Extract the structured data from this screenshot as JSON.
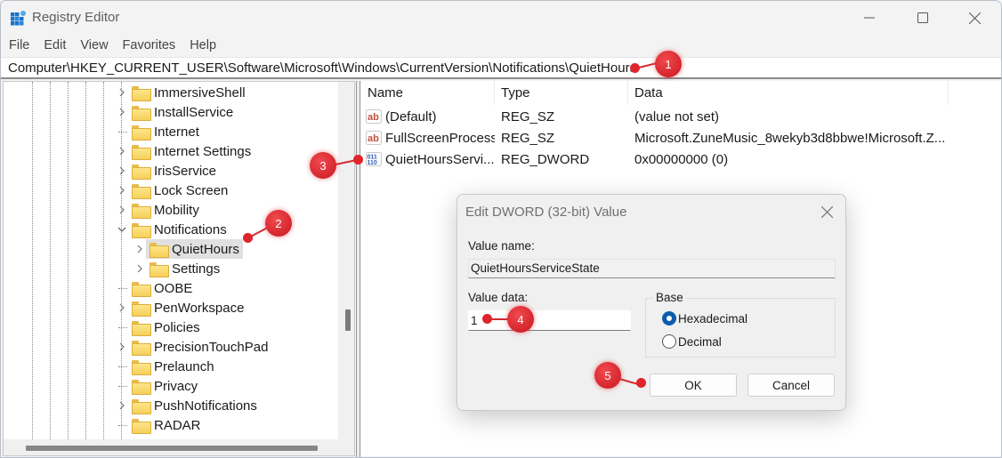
{
  "window": {
    "title": "Registry Editor",
    "controls": {
      "minimize": "minimize",
      "maximize": "maximize",
      "close": "close"
    }
  },
  "menu": [
    "File",
    "Edit",
    "View",
    "Favorites",
    "Help"
  ],
  "address": "Computer\\HKEY_CURRENT_USER\\Software\\Microsoft\\Windows\\CurrentVersion\\Notifications\\QuietHours",
  "tree": {
    "items": [
      {
        "label": "ImmersiveShell",
        "expander": "collapsed",
        "level": 0
      },
      {
        "label": "InstallService",
        "expander": "collapsed",
        "level": 0
      },
      {
        "label": "Internet",
        "expander": "none",
        "level": 0
      },
      {
        "label": "Internet Settings",
        "expander": "collapsed",
        "level": 0
      },
      {
        "label": "IrisService",
        "expander": "collapsed",
        "level": 0
      },
      {
        "label": "Lock Screen",
        "expander": "collapsed",
        "level": 0
      },
      {
        "label": "Mobility",
        "expander": "collapsed",
        "level": 0
      },
      {
        "label": "Notifications",
        "expander": "expanded",
        "level": 0
      },
      {
        "label": "QuietHours",
        "expander": "collapsed",
        "level": 1,
        "selected": true
      },
      {
        "label": "Settings",
        "expander": "collapsed",
        "level": 1
      },
      {
        "label": "OOBE",
        "expander": "none",
        "level": 0
      },
      {
        "label": "PenWorkspace",
        "expander": "collapsed",
        "level": 0
      },
      {
        "label": "Policies",
        "expander": "none",
        "level": 0
      },
      {
        "label": "PrecisionTouchPad",
        "expander": "collapsed",
        "level": 0
      },
      {
        "label": "Prelaunch",
        "expander": "none",
        "level": 0
      },
      {
        "label": "Privacy",
        "expander": "none",
        "level": 0
      },
      {
        "label": "PushNotifications",
        "expander": "collapsed",
        "level": 0
      },
      {
        "label": "RADAR",
        "expander": "none",
        "level": 0
      }
    ]
  },
  "list": {
    "columns": [
      "Name",
      "Type",
      "Data"
    ],
    "rows": [
      {
        "icon": "string-value-icon",
        "name": "(Default)",
        "type": "REG_SZ",
        "data": "(value not set)"
      },
      {
        "icon": "string-value-icon",
        "name": "FullScreenProcess",
        "type": "REG_SZ",
        "data": "Microsoft.ZuneMusic_8wekyb3d8bbwe!Microsoft.Z..."
      },
      {
        "icon": "binary-value-icon",
        "name": "QuietHoursServi...",
        "type": "REG_DWORD",
        "data": "0x00000000 (0)"
      }
    ]
  },
  "dialog": {
    "title": "Edit DWORD (32-bit) Value",
    "value_name_label": "Value name:",
    "value_name": "QuietHoursServiceState",
    "value_data_label": "Value data:",
    "value_data": "1",
    "base_label": "Base",
    "base_options": [
      {
        "label": "Hexadecimal",
        "selected": true
      },
      {
        "label": "Decimal",
        "selected": false
      }
    ],
    "ok_label": "OK",
    "cancel_label": "Cancel"
  },
  "callouts": [
    "1",
    "2",
    "3",
    "4",
    "5"
  ],
  "colors": {
    "callout_red": "#e0242b",
    "radio_selected": "#0b5cad",
    "folder_yellow": "#f6cf5a"
  }
}
